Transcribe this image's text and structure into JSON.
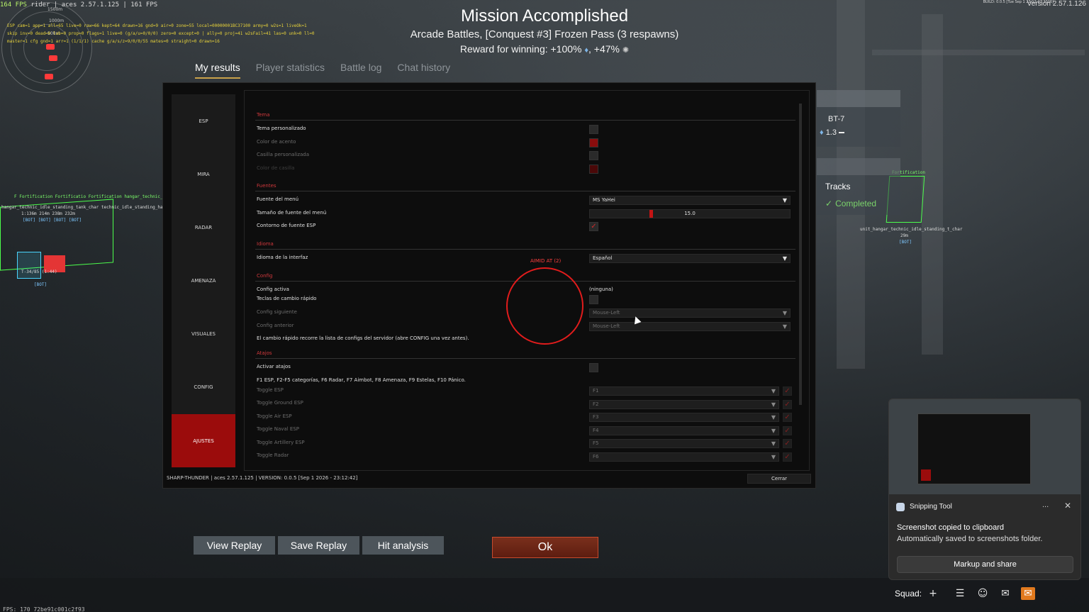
{
  "header": {
    "title": "Mission Accomplished",
    "subtitle": "Arcade Battles, [Conquest #3] Frozen Pass (3 respawns)",
    "reward_prefix": "Reward for winning: +100%",
    "reward_sep": ", +47%"
  },
  "tabs": [
    "My results",
    "Player statistics",
    "Battle log",
    "Chat history"
  ],
  "hud": {
    "fps_top": "164 FPS",
    "fps_top_rest": "rider | aces 2.57.1.125 | 161 FPS",
    "debug_lines": [
      "ESP cam=1 app=1 all=65 live=0 raw=66 kept=64 drawn=16 gnd=9 air=0 zone=55 local=00000001BC37100 army=0 w2s=1 liveOk=1",
      "skip inv=0 dead=0 lab=0 prop=0 flags=1 live=0 (g/a/u=0/0/0) zero=0 except=0 | ally=0 proj=41 w2sFail=41 las=0 unk=0 ll=0",
      "master=1 cfg gnd=1 arr=1 (1/1/1) cache g/a/s/z=9/0/0/55 mates=0 straight=0 drawn=16"
    ],
    "radar_labels": [
      "1500m",
      "1000m",
      "500m"
    ],
    "build": "BUILD: 0.0.5 [Tue Sep 1 23:12:42 2026]",
    "version": "Version 2.57.1.126",
    "fps_bottom": "FPS: 170   72be91c001c2f93",
    "aim_label": "AIMID AT (2)"
  },
  "esp": {
    "left_labels": [
      "F Fortification   Fortificatio Fortification hangar_technic_idle_standing_tank_char",
      "hangar_technic_idle_standing_tank_char technic_idle_standing_hangar_technic_idle_standing_tank_char",
      "1:136m        214m    238m   232m",
      "[BOT]          [BOT]    [BOT]   [BOT]"
    ],
    "cube_label": "T-34/85 (1:44)",
    "cube_bot": "[BOT]",
    "right_label_top": "Fortification",
    "right_label": "unit_hangar_technic_idle_standing_t_char",
    "right_dist": "29m",
    "right_bot": "[BOT]"
  },
  "vehicle": {
    "name": "BT-7",
    "br": "1.3"
  },
  "tracks": {
    "title": "Tracks",
    "status": "Completed"
  },
  "cheat": {
    "sidebar": [
      "ESP",
      "MIRA",
      "RADAR",
      "AMENAZA",
      "VISUALES",
      "CONFIG",
      "AJUSTES"
    ],
    "active_sidebar": "AJUSTES",
    "sections": {
      "tema": "Tema",
      "fuentes": "Fuentes",
      "idioma": "Idioma",
      "config": "Config",
      "atajos": "Atajos"
    },
    "tema": {
      "custom": "Tema personalizado",
      "accent": "Color de acento",
      "box_custom": "Casilla personalizada",
      "box_color": "Color de casilla"
    },
    "fuentes": {
      "menu_font": "Fuente del menú",
      "menu_font_value": "MS YaHei",
      "menu_size": "Tamaño de fuente del menú",
      "menu_size_value": "15.0",
      "menu_size_fraction": 0.11,
      "esp_outline": "Contorno de fuente ESP"
    },
    "idioma": {
      "label": "Idioma de la interfaz",
      "value": "Español"
    },
    "config": {
      "active": "Config activa",
      "active_value": "(ninguna)",
      "hotkeys": "Teclas de cambio rápido",
      "next": "Config siguiente",
      "next_value": "Mouse-Left",
      "prev": "Config anterior",
      "prev_value": "Mouse-Left",
      "note": "El cambio rápido recorre la lista de configs del servidor (abre CONFIG una vez antes)."
    },
    "atajos": {
      "enable": "Activar atajos",
      "hint": "F1 ESP, F2-F5 categorías, F6 Radar, F7 Aimbot, F8 Amenaza, F9 Estelas, F10 Pánico.",
      "rows": [
        {
          "label": "Toggle ESP",
          "key": "F1"
        },
        {
          "label": "Toggle Ground ESP",
          "key": "F2"
        },
        {
          "label": "Toggle Air ESP",
          "key": "F3"
        },
        {
          "label": "Toggle Naval ESP",
          "key": "F4"
        },
        {
          "label": "Toggle Artillery ESP",
          "key": "F5"
        },
        {
          "label": "Toggle Radar",
          "key": "F6"
        }
      ]
    },
    "footer": "SHARP-THUNDER | aces 2.57.1.125 | VERSION: 0.0.5 [Sep  1 2026 - 23:12:42]",
    "close": "Cerrar"
  },
  "buttons": {
    "view_replay": "View Replay",
    "save_replay": "Save Replay",
    "hit_analysis": "Hit analysis",
    "ok": "Ok"
  },
  "snip": {
    "app": "Snipping Tool",
    "more": "...",
    "close": "✕",
    "message": "Screenshot copied to clipboard",
    "sub": "Automatically saved to screenshots folder.",
    "action": "Markup and share"
  },
  "squad": {
    "label": "Squad:"
  },
  "icons": {
    "plus": "plus-icon",
    "list": "list-icon",
    "friends": "friends-icon",
    "chat": "chat-icon",
    "mail": "mail-icon"
  },
  "colors": {
    "accent_red": "#9b0c0c",
    "section_red": "#d0383c",
    "ok_orange": "#c94a2c",
    "completed_green": "#7ad26a"
  }
}
